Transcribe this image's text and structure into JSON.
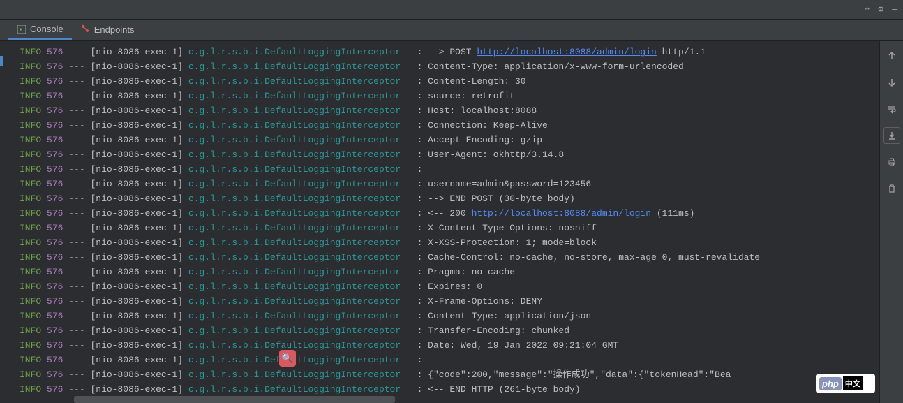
{
  "titlebar": {
    "target_icon": "⌖",
    "gear_icon": "⚙",
    "minimize_icon": "—"
  },
  "tabs": {
    "console": "Console",
    "endpoints": "Endpoints"
  },
  "side_tools": {
    "up": "↑",
    "down": "↓",
    "wrap": "⇥",
    "scroll_end": "⤓",
    "print": "🖶",
    "trash": "🗑"
  },
  "search_icon": "🔍",
  "logo": {
    "php": "php",
    "cn": "中文"
  },
  "log": {
    "level": "INFO",
    "pid": "576",
    "dashes": "---",
    "thread": "[nio-8086-exec-1]",
    "logger": "c.g.l.r.s.b.i.DefaultLoggingInterceptor",
    "colon": ":",
    "url1_text": "http://localhost:8088/admin/login",
    "url2_text": "http://localhost:8088/admin/login",
    "lines": [
      {
        "pre": "--> POST ",
        "url": 1,
        "post": " http/1.1"
      },
      {
        "text": "Content-Type: application/x-www-form-urlencoded"
      },
      {
        "text": "Content-Length: 30"
      },
      {
        "text": "source: retrofit"
      },
      {
        "text": "Host: localhost:8088"
      },
      {
        "text": "Connection: Keep-Alive"
      },
      {
        "text": "Accept-Encoding: gzip"
      },
      {
        "text": "User-Agent: okhttp/3.14.8"
      },
      {
        "text": ""
      },
      {
        "text": "username=admin&password=123456"
      },
      {
        "text": "--> END POST (30-byte body)"
      },
      {
        "pre": "<-- 200 ",
        "url": 2,
        "post": " (111ms)"
      },
      {
        "text": "X-Content-Type-Options: nosniff"
      },
      {
        "text": "X-XSS-Protection: 1; mode=block"
      },
      {
        "text": "Cache-Control: no-cache, no-store, max-age=0, must-revalidate"
      },
      {
        "text": "Pragma: no-cache"
      },
      {
        "text": "Expires: 0"
      },
      {
        "text": "X-Frame-Options: DENY"
      },
      {
        "text": "Content-Type: application/json"
      },
      {
        "text": "Transfer-Encoding: chunked"
      },
      {
        "text": "Date: Wed, 19 Jan 2022 09:21:04 GMT"
      },
      {
        "text": ""
      },
      {
        "text": "{\"code\":200,\"message\":\"操作成功\",\"data\":{\"tokenHead\":\"Bea"
      },
      {
        "text": "<-- END HTTP (261-byte body)"
      }
    ]
  }
}
